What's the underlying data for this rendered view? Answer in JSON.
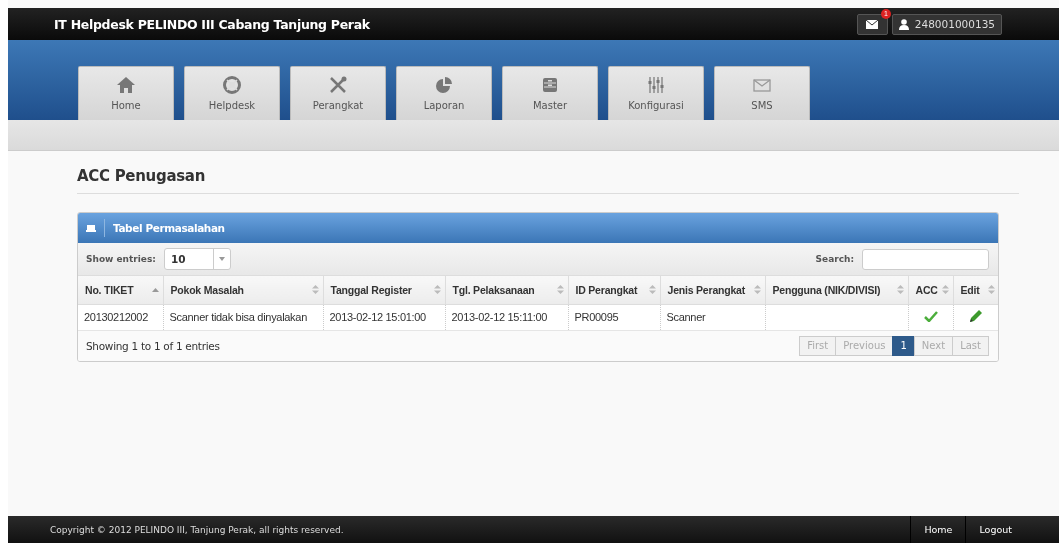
{
  "header": {
    "title": "IT Helpdesk PELINDO III Cabang Tanjung Perak",
    "message_badge": "1",
    "user": "248001000135"
  },
  "nav": [
    {
      "label": "Home",
      "selected": false
    },
    {
      "label": "Helpdesk",
      "selected": false
    },
    {
      "label": "Perangkat",
      "selected": false
    },
    {
      "label": "Laporan",
      "selected": false
    },
    {
      "label": "Master",
      "selected": false
    },
    {
      "label": "Konfigurasi",
      "selected": false
    },
    {
      "label": "SMS",
      "selected": false
    }
  ],
  "page_title": "ACC Penugasan",
  "panel": {
    "title": "Tabel Permasalahan",
    "show_entries_label": "Show entries:",
    "entries_value": "10",
    "search_label": "Search:",
    "columns": [
      {
        "label": "No. TIKET",
        "sorted_ascending": true
      },
      {
        "label": "Pokok Masalah",
        "sorted_ascending": false
      },
      {
        "label": "Tanggal Register",
        "sorted_ascending": false
      },
      {
        "label": "Tgl. Pelaksanaan",
        "sorted_ascending": false
      },
      {
        "label": "ID Perangkat",
        "sorted_ascending": false
      },
      {
        "label": "Jenis Perangkat",
        "sorted_ascending": false
      },
      {
        "label": "Pengguna (NIK/DIVISI)",
        "sorted_ascending": false
      },
      {
        "label": "ACC",
        "sorted_ascending": false
      },
      {
        "label": "Edit",
        "sorted_ascending": false
      }
    ],
    "rows": [
      {
        "cells": [
          "20130212002",
          "Scanner tidak bisa dinyalakan",
          "2013-02-12 15:01:00",
          "2013-02-12 15:11:00",
          "PR00095",
          "Scanner",
          ""
        ],
        "acc": true
      }
    ],
    "info": "Showing 1 to 1 of 1 entries",
    "pagination": [
      {
        "label": "First",
        "selected": false,
        "disabled": true
      },
      {
        "label": "Previous",
        "selected": false,
        "disabled": true
      },
      {
        "label": "1",
        "selected": true,
        "disabled": false
      },
      {
        "label": "Next",
        "selected": false,
        "disabled": true
      },
      {
        "label": "Last",
        "selected": false,
        "disabled": true
      }
    ]
  },
  "footer": {
    "copyright": "Copyright © 2012 PELINDO III, Tanjung Perak, all rights reserved.",
    "links": [
      "Home",
      "Logout"
    ]
  }
}
